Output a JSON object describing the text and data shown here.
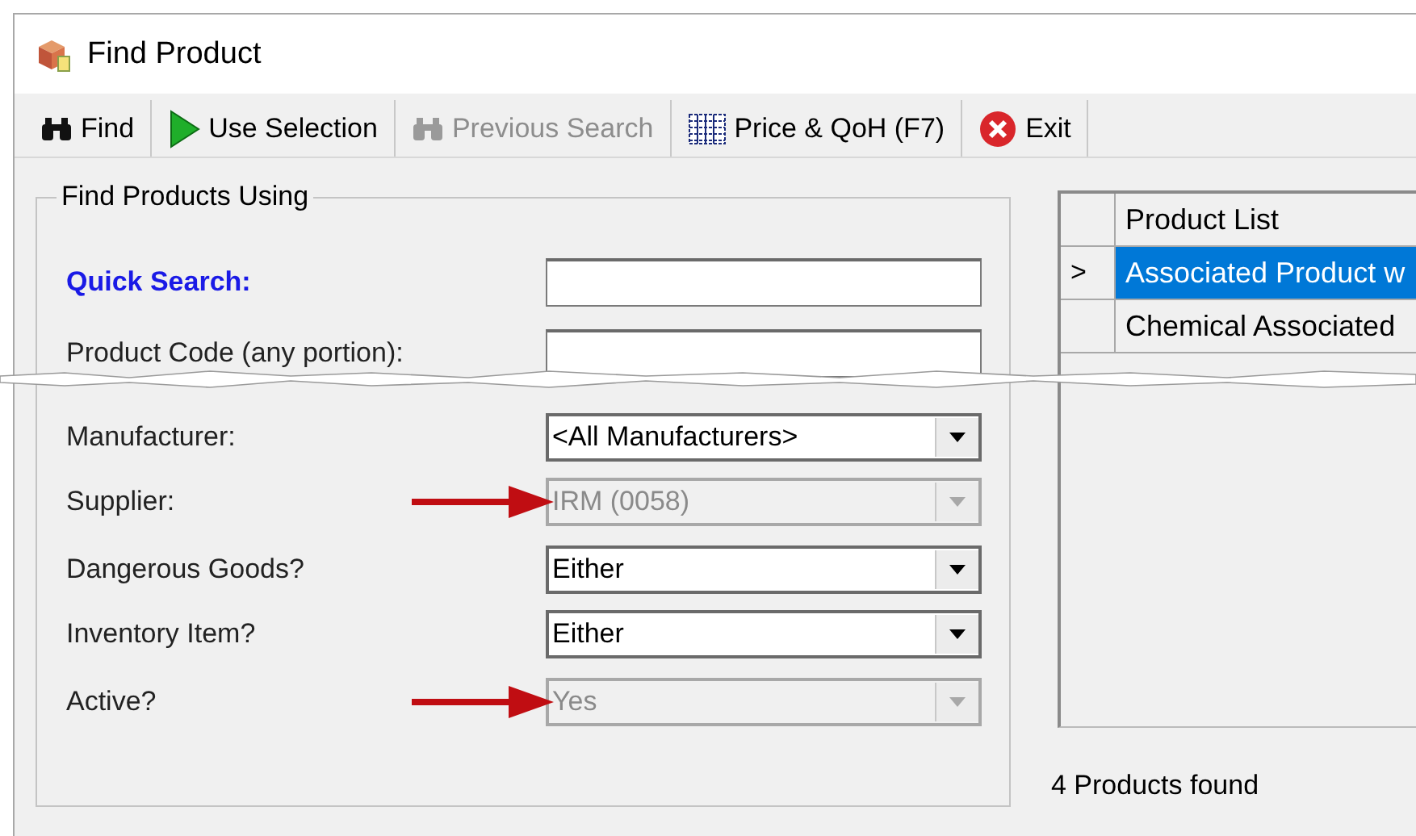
{
  "window": {
    "title": "Find Product"
  },
  "toolbar": [
    {
      "label": "Find",
      "kind": "find",
      "disabled": false
    },
    {
      "label": "Use Selection",
      "kind": "use",
      "disabled": false
    },
    {
      "label": "Previous Search",
      "kind": "find",
      "disabled": true
    },
    {
      "label": "Price & QoH (F7)",
      "kind": "price",
      "disabled": false
    },
    {
      "label": "Exit",
      "kind": "exit",
      "disabled": false
    }
  ],
  "search_group": {
    "title": "Find Products Using",
    "fields": [
      {
        "label": "Quick Search:",
        "kind": "text",
        "emphasized": true,
        "disabled": false,
        "marked": false
      },
      {
        "label": "Product Code (any portion):",
        "kind": "text",
        "emphasized": false,
        "disabled": false,
        "marked": false
      },
      {
        "label": "Manufacturer:",
        "kind": "dropdown",
        "value": "<All Manufacturers>",
        "emphasized": false,
        "disabled": false,
        "marked": false
      },
      {
        "label": "Supplier:",
        "kind": "dropdown",
        "value": "IRM (0058)",
        "emphasized": false,
        "disabled": true,
        "marked": true
      },
      {
        "label": "Dangerous Goods?",
        "kind": "dropdown",
        "value": "Either",
        "emphasized": false,
        "disabled": false,
        "marked": false
      },
      {
        "label": "Inventory Item?",
        "kind": "dropdown",
        "value": "Either",
        "emphasized": false,
        "disabled": false,
        "marked": false
      },
      {
        "label": "Active?",
        "kind": "dropdown",
        "value": "Yes",
        "emphasized": false,
        "disabled": true,
        "marked": true
      }
    ]
  },
  "product_grid": {
    "columns": [
      "Product List"
    ],
    "rows": [
      {
        "marker": ">",
        "cells": [
          "Associated Product w"
        ],
        "selected": true
      },
      {
        "cells": [
          "Chemical Associated"
        ],
        "selected": false
      }
    ]
  },
  "status": "4 Products found"
}
